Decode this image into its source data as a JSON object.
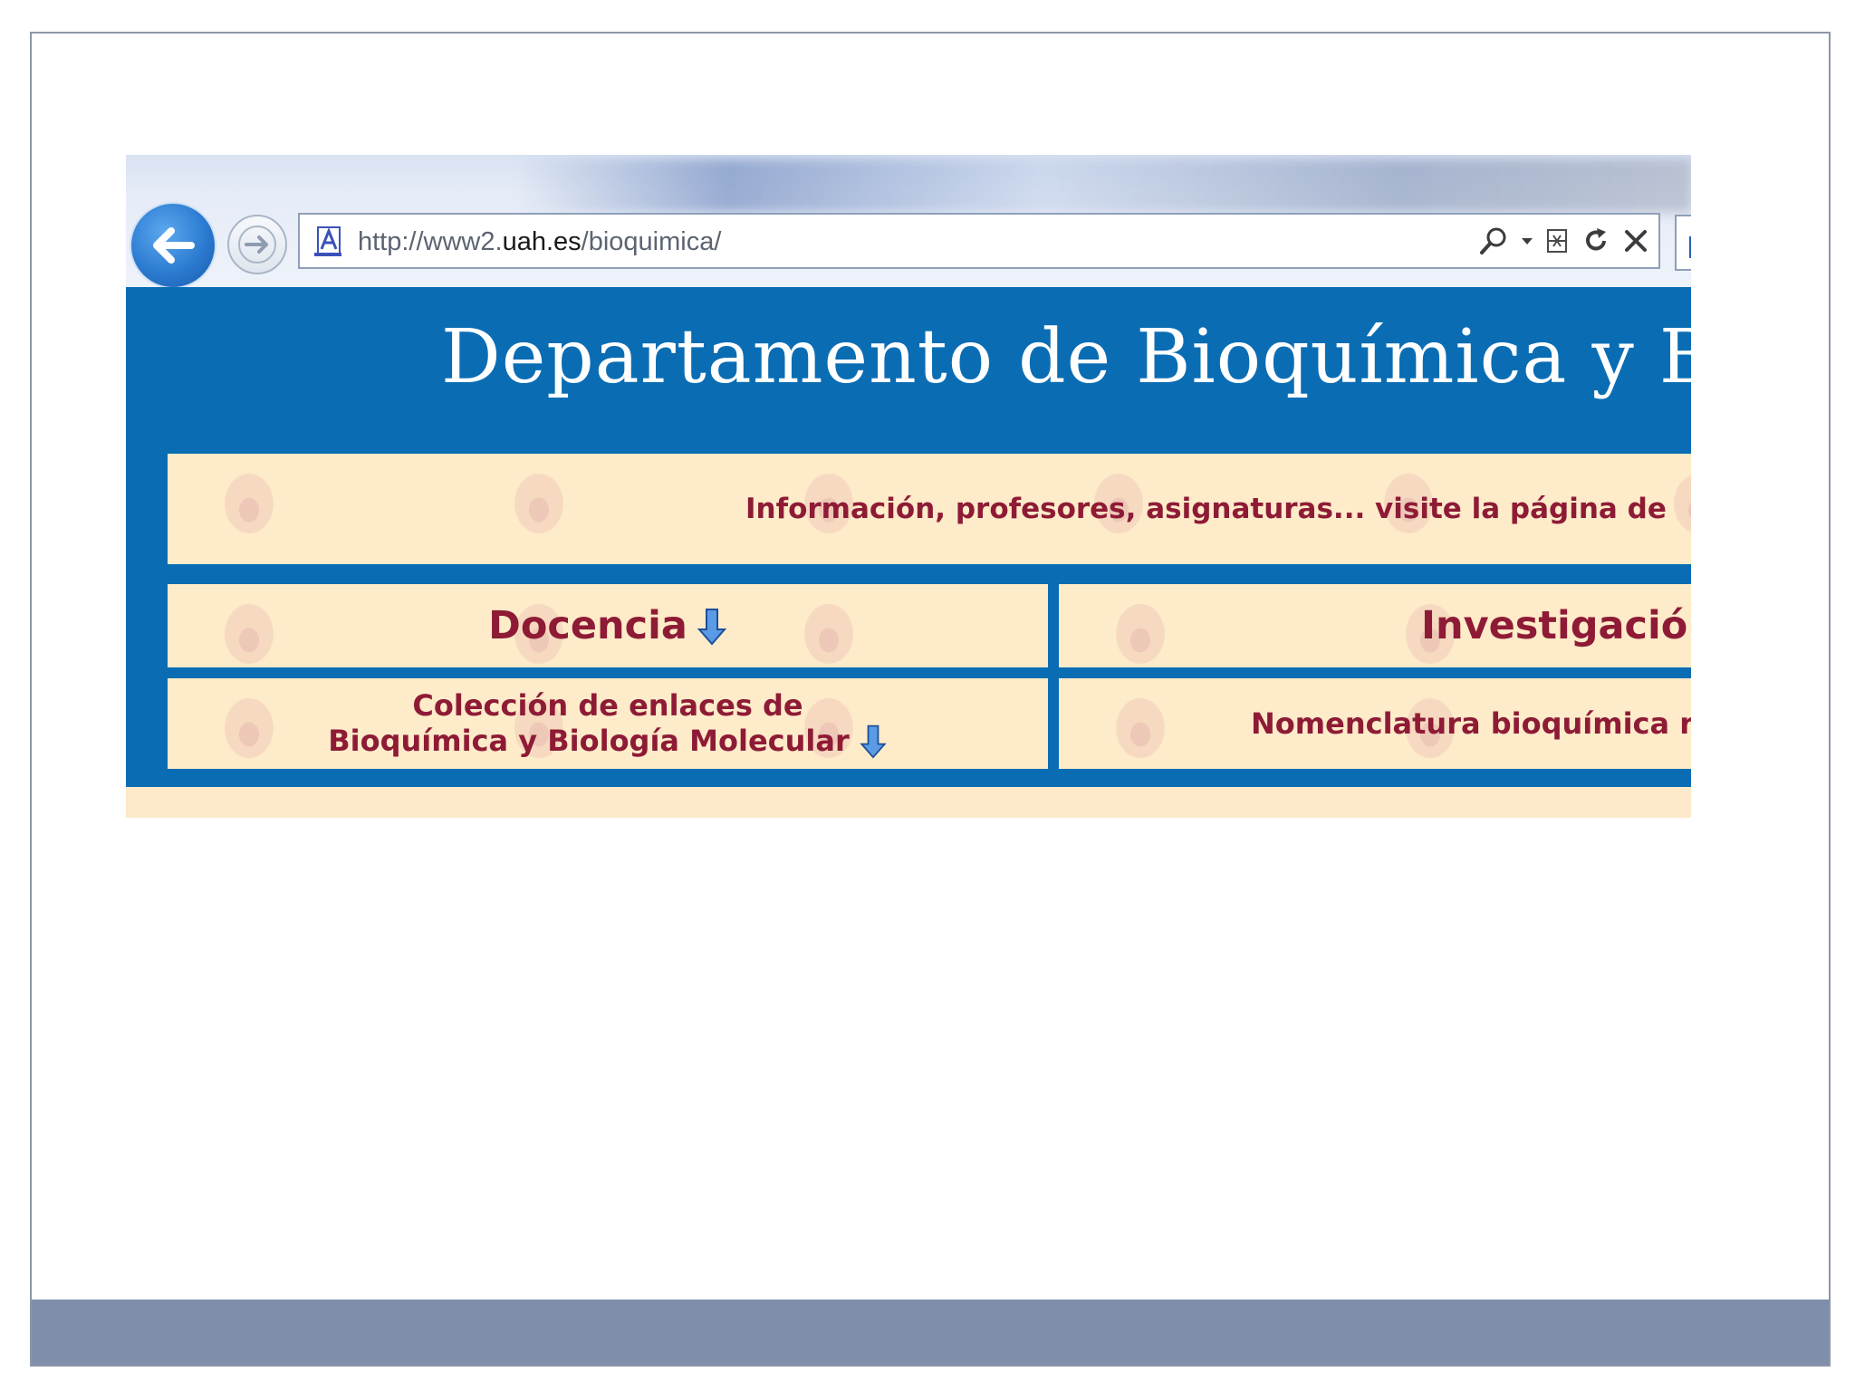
{
  "browser": {
    "url_prefix": "http://www2.",
    "url_domain": "uah.es",
    "url_path": "/bioquimica/",
    "icons": [
      "back-arrow-icon",
      "forward-arrow-icon",
      "page-icon",
      "search-icon",
      "dropdown-icon",
      "compatibility-icon",
      "refresh-icon",
      "stop-icon"
    ]
  },
  "page": {
    "title": "Departamento de Bioquímica y B",
    "info_text": "Información, profesores, asignaturas... visite la página de",
    "docencia_label": "Docencia",
    "investigacion_label": "Investigació",
    "coleccion_line1": "Colección de enlaces de",
    "coleccion_line2": "Bioquímica y Biología Molecular",
    "nomenclatura_label": "Nomenclatura bioquímica r"
  },
  "colors": {
    "header_blue": "#0a6db4",
    "panel_cream": "#fdebc9",
    "link_crimson": "#8e1b36",
    "footer_bar": "#7f8faa"
  }
}
